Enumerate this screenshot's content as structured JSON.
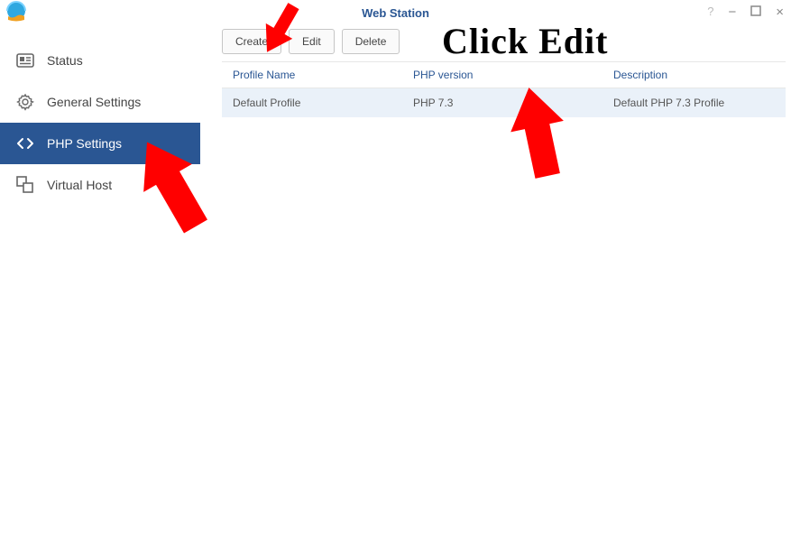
{
  "title": "Web Station",
  "sidebar": {
    "items": [
      {
        "label": "Status"
      },
      {
        "label": "General Settings"
      },
      {
        "label": "PHP Settings"
      },
      {
        "label": "Virtual Host"
      }
    ]
  },
  "toolbar": {
    "create": "Create",
    "edit": "Edit",
    "delete": "Delete"
  },
  "table": {
    "headers": {
      "profile": "Profile Name",
      "version": "PHP version",
      "desc": "Description"
    },
    "rows": [
      {
        "profile": "Default Profile",
        "version": "PHP 7.3",
        "desc": "Default PHP 7.3 Profile"
      }
    ]
  },
  "annotation": {
    "text": "Click Edit"
  }
}
